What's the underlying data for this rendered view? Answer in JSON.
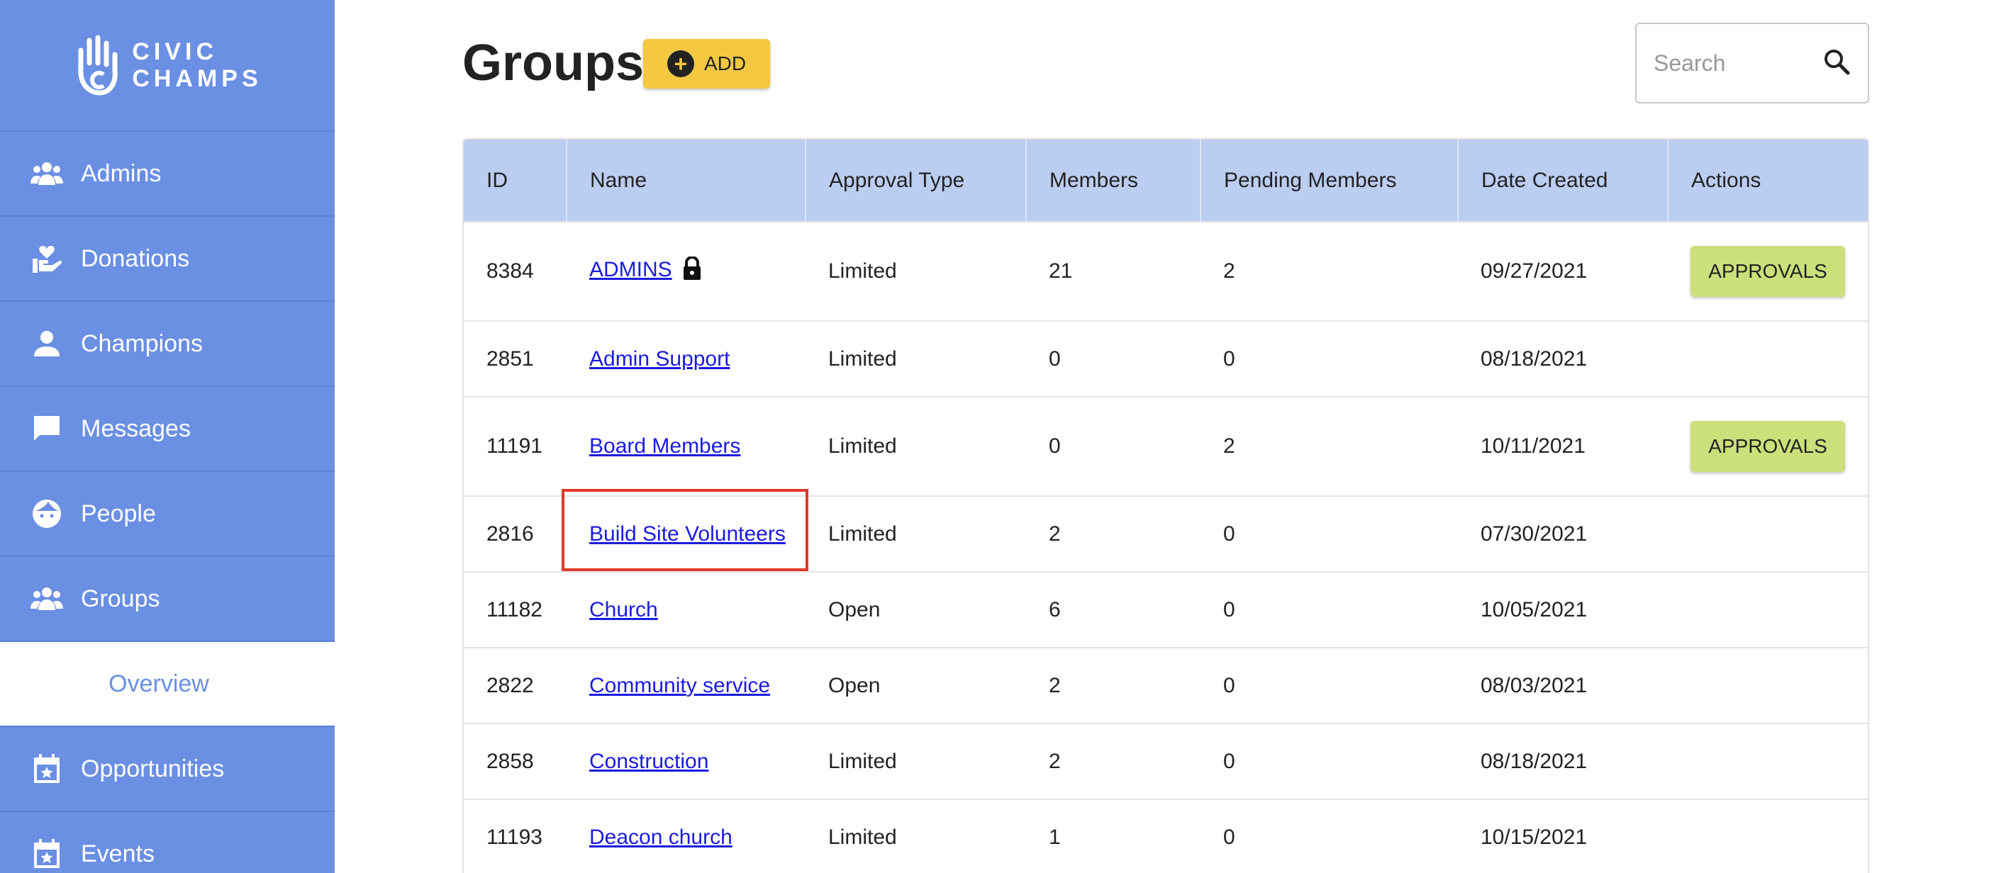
{
  "sidebar": {
    "logo": {
      "line1": "CIVIC",
      "line2": "CHAMPS"
    },
    "items": [
      {
        "label": "Admins",
        "icon": "people-group-icon"
      },
      {
        "label": "Donations",
        "icon": "donation-hand-icon"
      },
      {
        "label": "Champions",
        "icon": "person-icon"
      },
      {
        "label": "Messages",
        "icon": "chat-bubble-icon"
      },
      {
        "label": "People",
        "icon": "face-icon"
      },
      {
        "label": "Groups",
        "icon": "groups-icon"
      },
      {
        "label": "Overview",
        "icon": ""
      },
      {
        "label": "Opportunities",
        "icon": "calendar-star-icon"
      },
      {
        "label": "Events",
        "icon": "calendar-star-icon"
      }
    ]
  },
  "header": {
    "title": "Groups",
    "add_label": "ADD",
    "search_placeholder": "Search"
  },
  "table": {
    "columns": [
      "ID",
      "Name",
      "Approval Type",
      "Members",
      "Pending Members",
      "Date Created",
      "Actions"
    ],
    "approvals_label": "APPROVALS",
    "rows": [
      {
        "id": "8384",
        "name": "ADMINS",
        "approval_type": "Limited",
        "members": "21",
        "pending": "2",
        "date": "09/27/2021",
        "locked": true,
        "approvals": true
      },
      {
        "id": "2851",
        "name": "Admin Support",
        "approval_type": "Limited",
        "members": "0",
        "pending": "0",
        "date": "08/18/2021",
        "locked": false,
        "approvals": false
      },
      {
        "id": "11191",
        "name": "Board Members",
        "approval_type": "Limited",
        "members": "0",
        "pending": "2",
        "date": "10/11/2021",
        "locked": false,
        "approvals": true
      },
      {
        "id": "2816",
        "name": "Build Site Volunteers",
        "approval_type": "Limited",
        "members": "2",
        "pending": "0",
        "date": "07/30/2021",
        "locked": false,
        "approvals": false
      },
      {
        "id": "11182",
        "name": "Church",
        "approval_type": "Open",
        "members": "6",
        "pending": "0",
        "date": "10/05/2021",
        "locked": false,
        "approvals": false
      },
      {
        "id": "2822",
        "name": "Community service",
        "approval_type": "Open",
        "members": "2",
        "pending": "0",
        "date": "08/03/2021",
        "locked": false,
        "approvals": false
      },
      {
        "id": "2858",
        "name": "Construction",
        "approval_type": "Limited",
        "members": "2",
        "pending": "0",
        "date": "08/18/2021",
        "locked": false,
        "approvals": false
      },
      {
        "id": "11193",
        "name": "Deacon church",
        "approval_type": "Limited",
        "members": "1",
        "pending": "0",
        "date": "10/15/2021",
        "locked": false,
        "approvals": false
      }
    ]
  },
  "colors": {
    "sidebar_bg": "#6a8fe3",
    "header_row_bg": "#bccdf2",
    "add_button": "#f5c842",
    "approvals_button": "#cbe07a",
    "link": "#1b1be0",
    "highlight": "#e03a2a"
  }
}
